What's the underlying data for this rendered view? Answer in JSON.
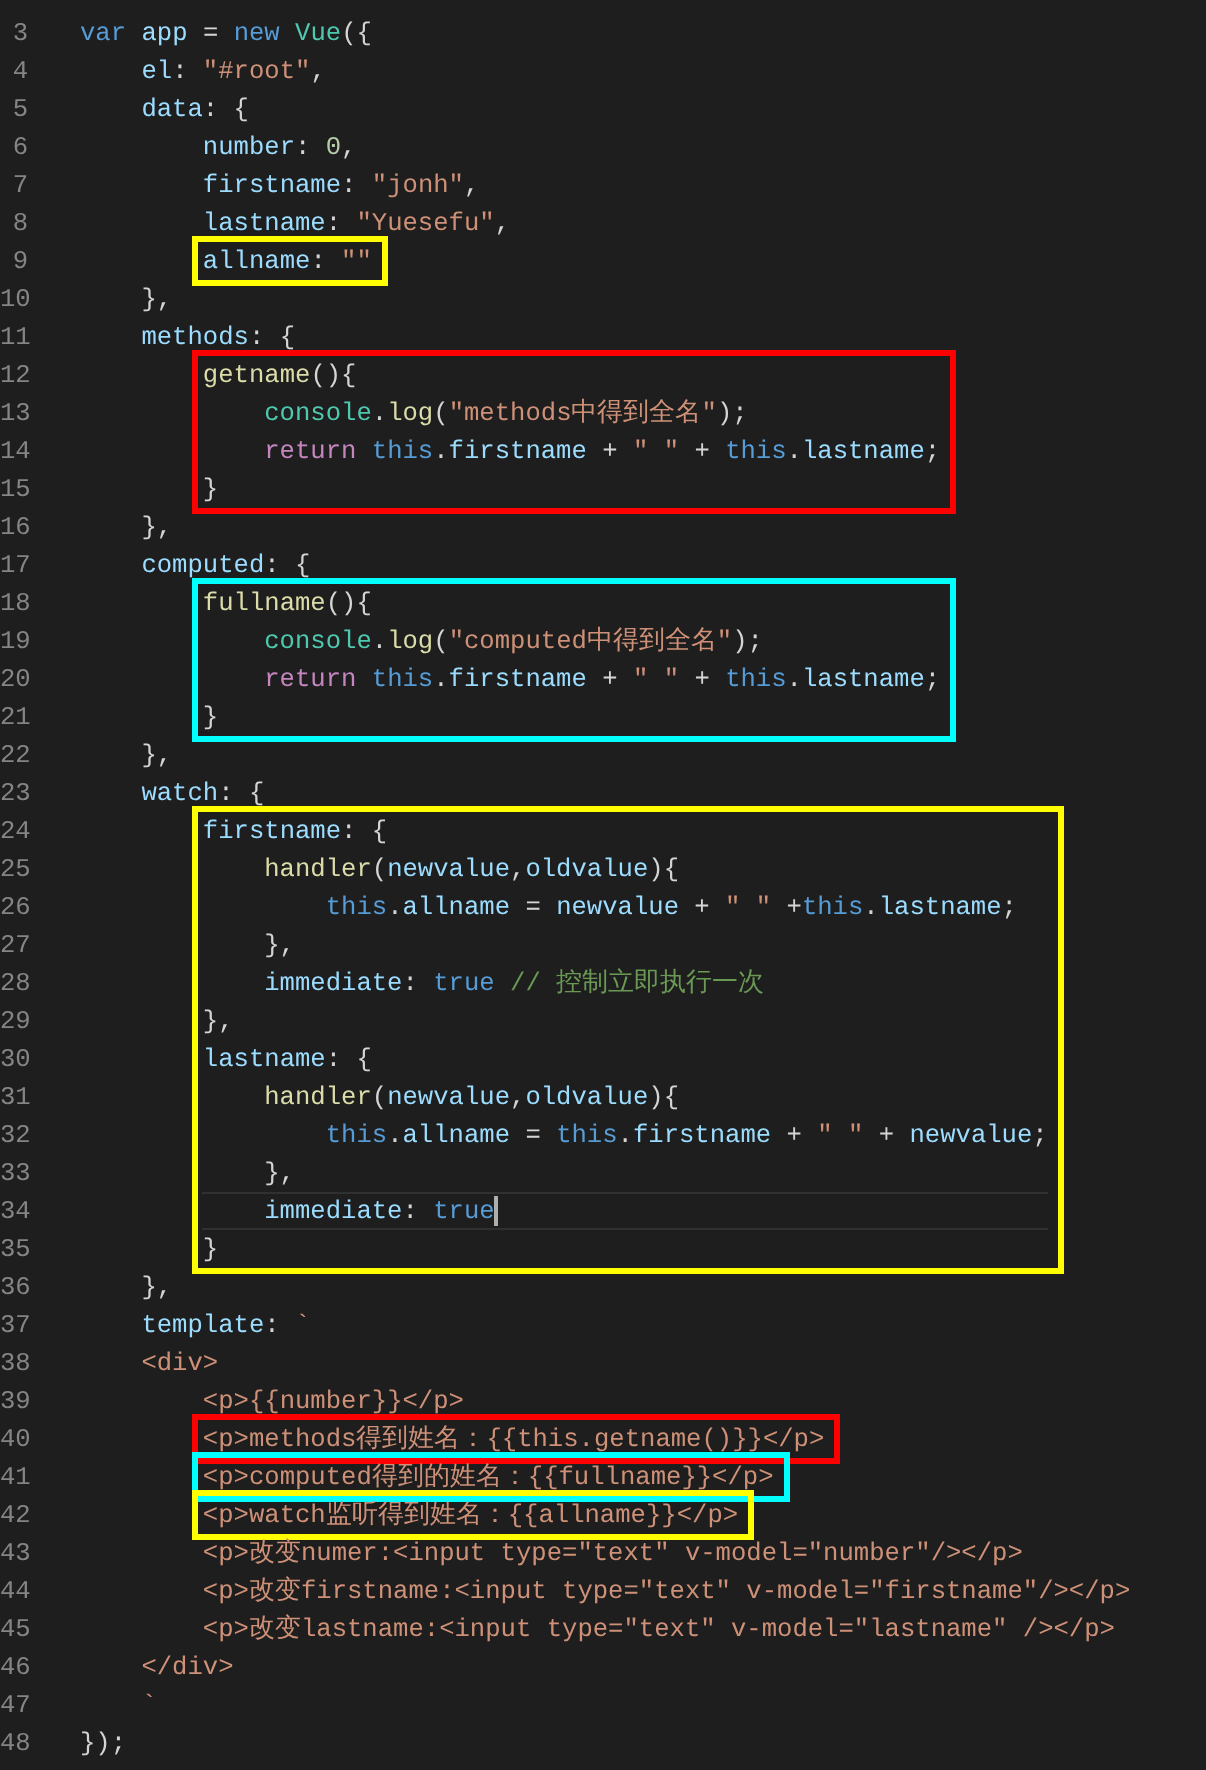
{
  "code": [
    {
      "kind": "plain",
      "lines": [
        {
          "number": "3",
          "current": false,
          "tokens": [
            {
              "kind": "keyword",
              "text": "var "
            },
            {
              "kind": "variable",
              "text": "app"
            },
            {
              "kind": "plain",
              "text": " = "
            },
            {
              "kind": "keyword",
              "text": "new "
            },
            {
              "kind": "type",
              "text": "Vue"
            },
            {
              "kind": "plain",
              "text": "({"
            }
          ]
        },
        {
          "number": "4",
          "current": false,
          "tokens": [
            {
              "kind": "variable",
              "text": "    el"
            },
            {
              "kind": "plain",
              "text": ": "
            },
            {
              "kind": "string",
              "text": "\"#root\""
            },
            {
              "kind": "plain",
              "text": ","
            }
          ]
        },
        {
          "number": "5",
          "current": false,
          "tokens": [
            {
              "kind": "variable",
              "text": "    data"
            },
            {
              "kind": "plain",
              "text": ": {"
            }
          ]
        },
        {
          "number": "6",
          "current": false,
          "tokens": [
            {
              "kind": "variable",
              "text": "        number"
            },
            {
              "kind": "plain",
              "text": ": "
            },
            {
              "kind": "number",
              "text": "0"
            },
            {
              "kind": "plain",
              "text": ","
            }
          ]
        },
        {
          "number": "7",
          "current": false,
          "tokens": [
            {
              "kind": "variable",
              "text": "        firstname"
            },
            {
              "kind": "plain",
              "text": ": "
            },
            {
              "kind": "string",
              "text": "\"jonh\""
            },
            {
              "kind": "plain",
              "text": ","
            }
          ]
        },
        {
          "number": "8",
          "current": false,
          "tokens": [
            {
              "kind": "variable",
              "text": "        lastname"
            },
            {
              "kind": "plain",
              "text": ": "
            },
            {
              "kind": "string",
              "text": "\"Yuesefu\""
            },
            {
              "kind": "plain",
              "text": ","
            }
          ]
        }
      ]
    },
    {
      "kind": "box",
      "color": "#ffff00",
      "lines": [
        {
          "number": "9",
          "current": false,
          "tokens": [
            {
              "kind": "variable",
              "text": "        allname"
            },
            {
              "kind": "plain",
              "text": ": "
            },
            {
              "kind": "string",
              "text": "\"\""
            }
          ]
        }
      ]
    },
    {
      "kind": "plain",
      "lines": [
        {
          "number": "10",
          "current": false,
          "tokens": [
            {
              "kind": "plain",
              "text": "    },"
            }
          ]
        },
        {
          "number": "11",
          "current": false,
          "tokens": [
            {
              "kind": "variable",
              "text": "    methods"
            },
            {
              "kind": "plain",
              "text": ": {"
            }
          ]
        }
      ]
    },
    {
      "kind": "box",
      "color": "#ff0000",
      "lines": [
        {
          "number": "12",
          "current": false,
          "tokens": [
            {
              "kind": "function",
              "text": "        getname"
            },
            {
              "kind": "plain",
              "text": "(){"
            }
          ]
        },
        {
          "number": "13",
          "current": false,
          "tokens": [
            {
              "kind": "type",
              "text": "            console"
            },
            {
              "kind": "plain",
              "text": "."
            },
            {
              "kind": "function",
              "text": "log"
            },
            {
              "kind": "plain",
              "text": "("
            },
            {
              "kind": "string",
              "text": "\"methods中得到全名\""
            },
            {
              "kind": "plain",
              "text": ");"
            }
          ]
        },
        {
          "number": "14",
          "current": false,
          "tokens": [
            {
              "kind": "control",
              "text": "            return "
            },
            {
              "kind": "keyword",
              "text": "this"
            },
            {
              "kind": "plain",
              "text": "."
            },
            {
              "kind": "variable",
              "text": "firstname"
            },
            {
              "kind": "plain",
              "text": " + "
            },
            {
              "kind": "string",
              "text": "\" \""
            },
            {
              "kind": "plain",
              "text": " + "
            },
            {
              "kind": "keyword",
              "text": "this"
            },
            {
              "kind": "plain",
              "text": "."
            },
            {
              "kind": "variable",
              "text": "lastname"
            },
            {
              "kind": "plain",
              "text": ";"
            }
          ]
        },
        {
          "number": "15",
          "current": false,
          "tokens": [
            {
              "kind": "plain",
              "text": "        }"
            }
          ]
        }
      ]
    },
    {
      "kind": "plain",
      "lines": [
        {
          "number": "16",
          "current": false,
          "tokens": [
            {
              "kind": "plain",
              "text": "    },"
            }
          ]
        },
        {
          "number": "17",
          "current": false,
          "tokens": [
            {
              "kind": "variable",
              "text": "    computed"
            },
            {
              "kind": "plain",
              "text": ": {"
            }
          ]
        }
      ]
    },
    {
      "kind": "box",
      "color": "#00ffff",
      "lines": [
        {
          "number": "18",
          "current": false,
          "tokens": [
            {
              "kind": "function",
              "text": "        fullname"
            },
            {
              "kind": "plain",
              "text": "(){"
            }
          ]
        },
        {
          "number": "19",
          "current": false,
          "tokens": [
            {
              "kind": "type",
              "text": "            console"
            },
            {
              "kind": "plain",
              "text": "."
            },
            {
              "kind": "function",
              "text": "log"
            },
            {
              "kind": "plain",
              "text": "("
            },
            {
              "kind": "string",
              "text": "\"computed中得到全名\""
            },
            {
              "kind": "plain",
              "text": ");"
            }
          ]
        },
        {
          "number": "20",
          "current": false,
          "tokens": [
            {
              "kind": "control",
              "text": "            return "
            },
            {
              "kind": "keyword",
              "text": "this"
            },
            {
              "kind": "plain",
              "text": "."
            },
            {
              "kind": "variable",
              "text": "firstname"
            },
            {
              "kind": "plain",
              "text": " + "
            },
            {
              "kind": "string",
              "text": "\" \""
            },
            {
              "kind": "plain",
              "text": " + "
            },
            {
              "kind": "keyword",
              "text": "this"
            },
            {
              "kind": "plain",
              "text": "."
            },
            {
              "kind": "variable",
              "text": "lastname"
            },
            {
              "kind": "plain",
              "text": ";"
            }
          ]
        },
        {
          "number": "21",
          "current": false,
          "tokens": [
            {
              "kind": "plain",
              "text": "        }"
            }
          ]
        }
      ]
    },
    {
      "kind": "plain",
      "lines": [
        {
          "number": "22",
          "current": false,
          "tokens": [
            {
              "kind": "plain",
              "text": "    },"
            }
          ]
        },
        {
          "number": "23",
          "current": false,
          "tokens": [
            {
              "kind": "variable",
              "text": "    watch"
            },
            {
              "kind": "plain",
              "text": ": {"
            }
          ]
        }
      ]
    },
    {
      "kind": "box",
      "color": "#ffff00",
      "lines": [
        {
          "number": "24",
          "current": false,
          "tokens": [
            {
              "kind": "variable",
              "text": "        firstname"
            },
            {
              "kind": "plain",
              "text": ": {"
            }
          ]
        },
        {
          "number": "25",
          "current": false,
          "tokens": [
            {
              "kind": "function",
              "text": "            handler"
            },
            {
              "kind": "plain",
              "text": "("
            },
            {
              "kind": "variable",
              "text": "newvalue"
            },
            {
              "kind": "plain",
              "text": ","
            },
            {
              "kind": "variable",
              "text": "oldvalue"
            },
            {
              "kind": "plain",
              "text": "){"
            }
          ]
        },
        {
          "number": "26",
          "current": false,
          "tokens": [
            {
              "kind": "keyword",
              "text": "                this"
            },
            {
              "kind": "plain",
              "text": "."
            },
            {
              "kind": "variable",
              "text": "allname"
            },
            {
              "kind": "plain",
              "text": " = "
            },
            {
              "kind": "variable",
              "text": "newvalue"
            },
            {
              "kind": "plain",
              "text": " + "
            },
            {
              "kind": "string",
              "text": "\" \""
            },
            {
              "kind": "plain",
              "text": " +"
            },
            {
              "kind": "keyword",
              "text": "this"
            },
            {
              "kind": "plain",
              "text": "."
            },
            {
              "kind": "variable",
              "text": "lastname"
            },
            {
              "kind": "plain",
              "text": ";"
            }
          ]
        },
        {
          "number": "27",
          "current": false,
          "tokens": [
            {
              "kind": "plain",
              "text": "            },"
            }
          ]
        },
        {
          "number": "28",
          "current": false,
          "tokens": [
            {
              "kind": "variable",
              "text": "            immediate"
            },
            {
              "kind": "plain",
              "text": ": "
            },
            {
              "kind": "keyword",
              "text": "true "
            },
            {
              "kind": "comment",
              "text": "// 控制立即执行一次"
            }
          ]
        },
        {
          "number": "29",
          "current": false,
          "tokens": [
            {
              "kind": "plain",
              "text": "        },"
            }
          ]
        },
        {
          "number": "30",
          "current": false,
          "tokens": [
            {
              "kind": "variable",
              "text": "        lastname"
            },
            {
              "kind": "plain",
              "text": ": {"
            }
          ]
        },
        {
          "number": "31",
          "current": false,
          "tokens": [
            {
              "kind": "function",
              "text": "            handler"
            },
            {
              "kind": "plain",
              "text": "("
            },
            {
              "kind": "variable",
              "text": "newvalue"
            },
            {
              "kind": "plain",
              "text": ","
            },
            {
              "kind": "variable",
              "text": "oldvalue"
            },
            {
              "kind": "plain",
              "text": "){"
            }
          ]
        },
        {
          "number": "32",
          "current": false,
          "tokens": [
            {
              "kind": "keyword",
              "text": "                this"
            },
            {
              "kind": "plain",
              "text": "."
            },
            {
              "kind": "variable",
              "text": "allname"
            },
            {
              "kind": "plain",
              "text": " = "
            },
            {
              "kind": "keyword",
              "text": "this"
            },
            {
              "kind": "plain",
              "text": "."
            },
            {
              "kind": "variable",
              "text": "firstname"
            },
            {
              "kind": "plain",
              "text": " + "
            },
            {
              "kind": "string",
              "text": "\" \""
            },
            {
              "kind": "plain",
              "text": " + "
            },
            {
              "kind": "variable",
              "text": "newvalue"
            },
            {
              "kind": "plain",
              "text": ";"
            }
          ]
        },
        {
          "number": "33",
          "current": false,
          "tokens": [
            {
              "kind": "plain",
              "text": "            },"
            }
          ]
        },
        {
          "number": "34",
          "current": true,
          "tokens": [
            {
              "kind": "variable",
              "text": "            immediate"
            },
            {
              "kind": "plain",
              "text": ": "
            },
            {
              "kind": "keyword",
              "text": "true"
            }
          ]
        },
        {
          "number": "35",
          "current": false,
          "tokens": [
            {
              "kind": "plain",
              "text": "        }"
            }
          ]
        }
      ]
    },
    {
      "kind": "plain",
      "lines": [
        {
          "number": "36",
          "current": false,
          "tokens": [
            {
              "kind": "plain",
              "text": "    },"
            }
          ]
        },
        {
          "number": "37",
          "current": false,
          "tokens": [
            {
              "kind": "variable",
              "text": "    template"
            },
            {
              "kind": "plain",
              "text": ": "
            },
            {
              "kind": "string",
              "text": "`"
            }
          ]
        },
        {
          "number": "38",
          "current": false,
          "tokens": [
            {
              "kind": "string",
              "text": "    <div>"
            }
          ]
        },
        {
          "number": "39",
          "current": false,
          "tokens": [
            {
              "kind": "string",
              "text": "        <p>{{number}}</p>"
            }
          ]
        }
      ]
    },
    {
      "kind": "box",
      "color": "#ff0000",
      "lines": [
        {
          "number": "40",
          "current": false,
          "tokens": [
            {
              "kind": "string",
              "text": "        <p>methods得到姓名：{{this.getname()}}</p>"
            }
          ]
        }
      ]
    },
    {
      "kind": "box",
      "color": "#00ffff",
      "lines": [
        {
          "number": "41",
          "current": false,
          "tokens": [
            {
              "kind": "string",
              "text": "        <p>computed得到的姓名：{{fullname}}</p>"
            }
          ]
        }
      ]
    },
    {
      "kind": "box",
      "color": "#ffff00",
      "lines": [
        {
          "number": "42",
          "current": false,
          "tokens": [
            {
              "kind": "string",
              "text": "        <p>watch监听得到姓名：{{allname}}</p>"
            }
          ]
        }
      ]
    },
    {
      "kind": "plain",
      "lines": [
        {
          "number": "43",
          "current": false,
          "tokens": [
            {
              "kind": "string",
              "text": "        <p>改变numer:<input type=\"text\" v-model=\"number\"/></p>"
            }
          ]
        },
        {
          "number": "44",
          "current": false,
          "tokens": [
            {
              "kind": "string",
              "text": "        <p>改变firstname:<input type=\"text\" v-model=\"firstname\"/></p>"
            }
          ]
        },
        {
          "number": "45",
          "current": false,
          "tokens": [
            {
              "kind": "string",
              "text": "        <p>改变lastname:<input type=\"text\" v-model=\"lastname\" /></p>"
            }
          ]
        },
        {
          "number": "46",
          "current": false,
          "tokens": [
            {
              "kind": "string",
              "text": "    </div>"
            }
          ]
        },
        {
          "number": "47",
          "current": false,
          "tokens": [
            {
              "kind": "string",
              "text": "    `"
            }
          ]
        },
        {
          "number": "48",
          "current": false,
          "tokens": [
            {
              "kind": "plain",
              "text": "});"
            }
          ]
        }
      ]
    }
  ]
}
